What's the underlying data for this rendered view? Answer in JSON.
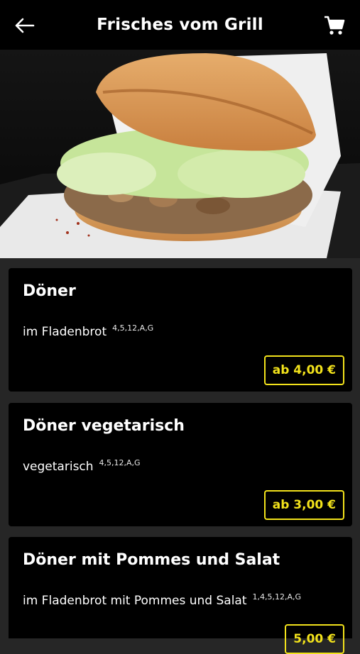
{
  "header": {
    "title": "Frisches vom Grill",
    "back_icon": "arrow-left-icon",
    "cart_icon": "cart-icon"
  },
  "hero": {
    "image": "doner-sandwich-photo"
  },
  "items": [
    {
      "name": "Döner",
      "description": "im Fladenbrot",
      "codes": "4,5,12,A,G",
      "price": "ab 4,00 €"
    },
    {
      "name": "Döner vegetarisch",
      "description": "vegetarisch",
      "codes": "4,5,12,A,G",
      "price": "ab 3,00 €"
    },
    {
      "name": "Döner mit Pommes und Salat",
      "description": "im Fladenbrot mit Pommes und Salat",
      "codes": "1,4,5,12,A,G",
      "price": "5,00 €"
    }
  ],
  "colors": {
    "accent": "#f2e21b",
    "background": "#262626",
    "card": "#000000"
  }
}
